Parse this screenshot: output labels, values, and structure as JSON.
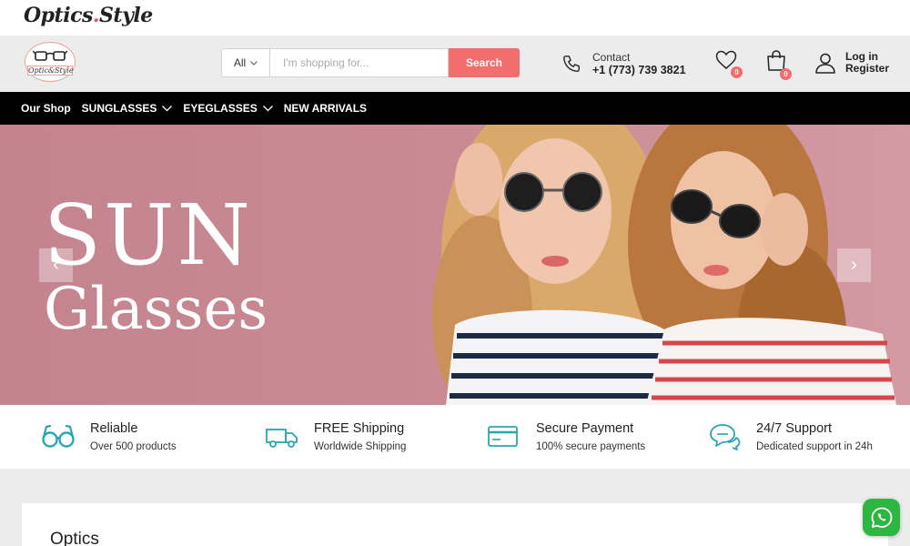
{
  "brand": {
    "name_left": "Optics",
    "name_right": "Style",
    "badge_text": "Optic&Style"
  },
  "search": {
    "category": "All",
    "placeholder": "I'm shopping for...",
    "button_label": "Search"
  },
  "contact": {
    "label": "Contact",
    "phone": "+1 (773) 739 3821"
  },
  "wishlist": {
    "count": "0"
  },
  "cart": {
    "count": "0"
  },
  "account": {
    "login_label": "Log in",
    "register_label": "Register"
  },
  "nav": {
    "items": [
      {
        "label": "Our Shop",
        "has_dropdown": false
      },
      {
        "label": "SUNGLASSES",
        "has_dropdown": true
      },
      {
        "label": "EYEGLASSES",
        "has_dropdown": true
      },
      {
        "label": "NEW ARRIVALS",
        "has_dropdown": false
      }
    ]
  },
  "hero": {
    "line1": "SUN",
    "line2": "Glasses",
    "prev_arrow": "‹",
    "next_arrow": "›"
  },
  "features": [
    {
      "icon": "glasses-icon",
      "title": "Reliable",
      "subtitle": "Over 500 products"
    },
    {
      "icon": "truck-icon",
      "title": "FREE Shipping",
      "subtitle": "Worldwide Shipping"
    },
    {
      "icon": "credit-card-icon",
      "title": "Secure Payment",
      "subtitle": "100% secure payments"
    },
    {
      "icon": "chat-icon",
      "title": "24/7 Support",
      "subtitle": "Dedicated support in 24h"
    }
  ],
  "section": {
    "title": "Optics"
  },
  "colors": {
    "accent": "#f26d6d",
    "teal": "#2aa6b0",
    "hero_bg": "#c98a93",
    "nav_bg": "#000000",
    "whatsapp": "#2db742"
  }
}
